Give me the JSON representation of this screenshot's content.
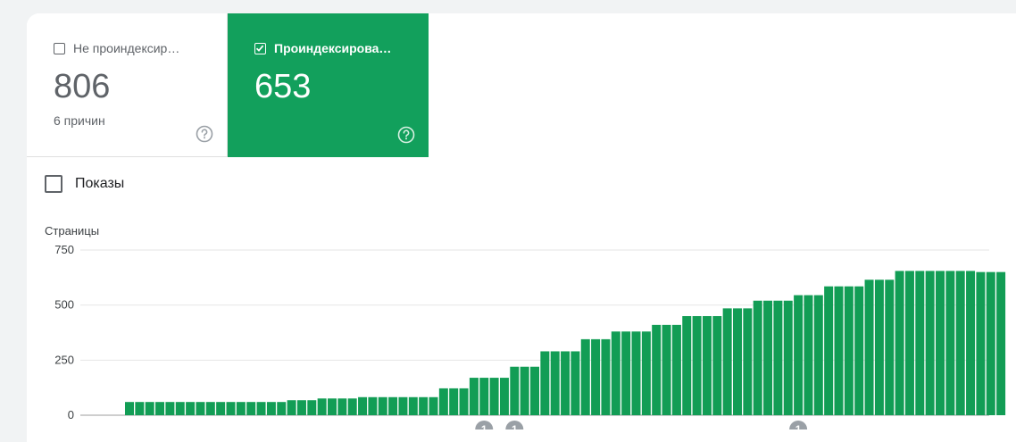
{
  "tiles": {
    "not_indexed": {
      "label": "Не проиндексир…",
      "value": "806",
      "sub": "6 причин",
      "checked": false
    },
    "indexed": {
      "label": "Проиндексирова…",
      "value": "653",
      "checked": true
    }
  },
  "impressions_toggle": {
    "label": "Показы",
    "checked": false
  },
  "colors": {
    "accent": "#12a05c",
    "bar": "#129d55",
    "grid": "#e6e6e6",
    "axis": "#3c4043",
    "annotation": "#9aa0a6"
  },
  "chart_data": {
    "type": "bar",
    "title": "",
    "xlabel": "",
    "ylabel": "Страницы",
    "ylim": [
      0,
      750
    ],
    "yticks": [
      0,
      250,
      500,
      750
    ],
    "ytick_labels": [
      "0",
      "250",
      "500",
      "750"
    ],
    "grid": true,
    "series": [
      {
        "values": [
          60,
          60,
          60,
          60,
          60,
          60,
          60,
          60,
          60,
          60,
          60,
          60,
          60,
          60,
          60,
          60,
          68,
          68,
          68,
          76,
          76,
          76,
          76,
          82,
          82,
          82,
          82,
          82,
          82,
          82,
          82,
          122,
          122,
          122,
          170,
          170,
          170,
          170,
          220,
          220,
          220,
          290,
          290,
          290,
          290,
          345,
          345,
          345,
          380,
          380,
          380,
          380,
          410,
          410,
          410,
          450,
          450,
          450,
          450,
          485,
          485,
          485,
          520,
          520,
          520,
          520,
          545,
          545,
          545,
          585,
          585,
          585,
          585,
          615,
          615,
          615,
          655,
          655,
          655,
          655,
          655,
          655,
          655,
          655,
          650,
          650,
          650
        ]
      }
    ],
    "annotations": [
      {
        "label": "1",
        "bar_index": 35
      },
      {
        "label": "1",
        "bar_index": 38
      },
      {
        "label": "1",
        "bar_index": 66
      }
    ]
  }
}
